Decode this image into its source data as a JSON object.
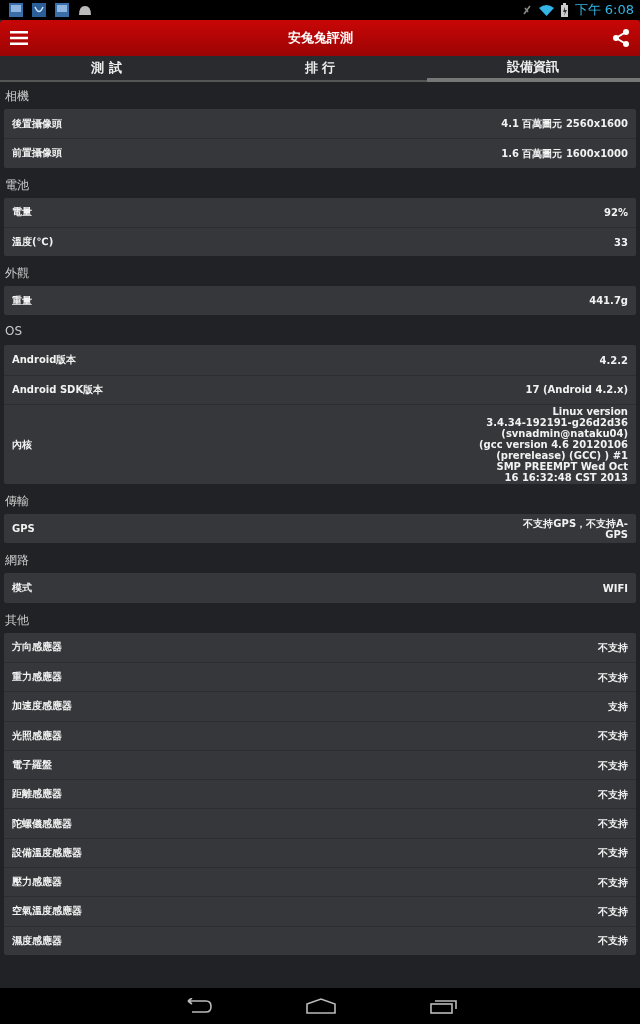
{
  "status_bar": {
    "time": "下午 6:08"
  },
  "app_bar": {
    "title": "安兔兔評測"
  },
  "tabs": [
    {
      "label": "測 試",
      "selected": false
    },
    {
      "label": "排 行",
      "selected": false
    },
    {
      "label": "設備資訊",
      "selected": true
    }
  ],
  "sections": [
    {
      "title": "相機",
      "rows": [
        {
          "label": "後置攝像頭",
          "value": "4.1 百萬圖元  2560x1600"
        },
        {
          "label": "前置攝像頭",
          "value": "1.6 百萬圖元  1600x1000"
        }
      ]
    },
    {
      "title": "電池",
      "rows": [
        {
          "label": "電量",
          "value": "92%"
        },
        {
          "label": "溫度(℃)",
          "value": "33"
        }
      ]
    },
    {
      "title": "外觀",
      "rows": [
        {
          "label": "重量",
          "value": "441.7g"
        }
      ]
    },
    {
      "title": "OS",
      "rows": [
        {
          "label": "Android版本",
          "value": "4.2.2"
        },
        {
          "label": "Android SDK版本",
          "value": "17  (Android 4.2.x)"
        },
        {
          "label": "內核",
          "value": "Linux version\n3.4.34-192191-g26d2d36\n(svnadmin@nataku04)\n(gcc version 4.6 20120106\n(prerelease) (GCC) ) #1\nSMP PREEMPT Wed Oct\n16 16:32:48 CST 2013"
        }
      ]
    },
    {
      "title": "傳輸",
      "rows": [
        {
          "label": "GPS",
          "value": "不支持GPS，不支持A-\nGPS"
        }
      ]
    },
    {
      "title": "網路",
      "rows": [
        {
          "label": "模式",
          "value": "WIFI"
        }
      ]
    },
    {
      "title": "其他",
      "rows": [
        {
          "label": "方向感應器",
          "value": "不支持"
        },
        {
          "label": "重力感應器",
          "value": "不支持"
        },
        {
          "label": "加速度感應器",
          "value": "支持"
        },
        {
          "label": "光照感應器",
          "value": "不支持"
        },
        {
          "label": "電子羅盤",
          "value": "不支持"
        },
        {
          "label": "距離感應器",
          "value": "不支持"
        },
        {
          "label": "陀螺儀感應器",
          "value": "不支持"
        },
        {
          "label": "設備溫度感應器",
          "value": "不支持"
        },
        {
          "label": "壓力感應器",
          "value": "不支持"
        },
        {
          "label": "空氣溫度感應器",
          "value": "不支持"
        },
        {
          "label": "濕度感應器",
          "value": "不支持"
        }
      ]
    }
  ]
}
